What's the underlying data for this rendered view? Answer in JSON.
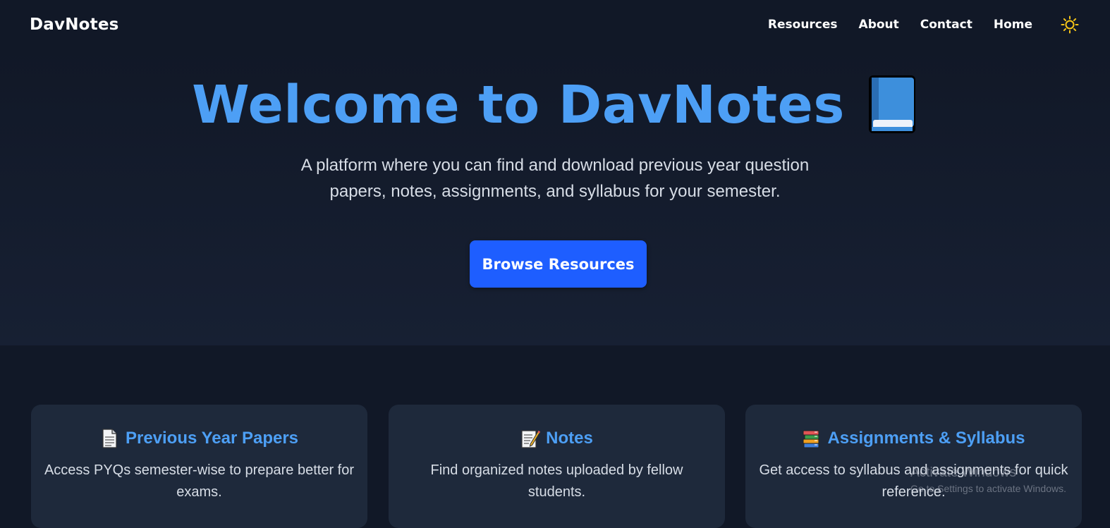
{
  "header": {
    "brand": "DavNotes",
    "nav": [
      "Resources",
      "About",
      "Contact",
      "Home"
    ],
    "theme_icon": "sun-icon",
    "theme_color": "#f5c518"
  },
  "hero": {
    "title": "Welcome to DavNotes",
    "title_icon": "book-icon",
    "subtitle": "A platform where you can find and download previous year question papers, notes, assignments, and syllabus for your semester.",
    "cta_label": "Browse Resources",
    "accent_color": "#4d9ff5",
    "button_color": "#1e5eff"
  },
  "features": [
    {
      "icon": "page-icon",
      "title": "Previous Year Papers",
      "description": "Access PYQs semester-wise to prepare better for exams."
    },
    {
      "icon": "memo-icon",
      "title": "Notes",
      "description": "Find organized notes uploaded by fellow students."
    },
    {
      "icon": "books-icon",
      "title": "Assignments & Syllabus",
      "description": "Get access to syllabus and assignments for quick reference."
    }
  ],
  "watermark": {
    "title": "Activate Windows",
    "subtitle": "Go to Settings to activate Windows."
  }
}
